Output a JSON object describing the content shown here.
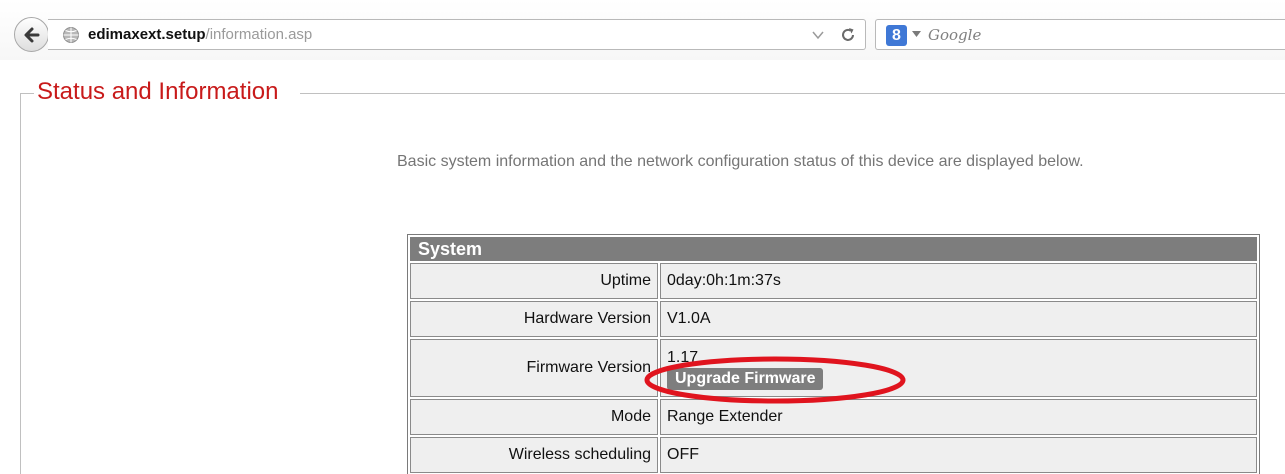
{
  "browser": {
    "url_host": "edimaxext.setup",
    "url_path": "/information.asp",
    "search_engine_label": "8",
    "search_placeholder": "Google"
  },
  "page": {
    "title": "Status and Information",
    "intro": "Basic system information and the network configuration status of this device are displayed below."
  },
  "system": {
    "header": "System",
    "rows": [
      {
        "label": "Uptime",
        "value": "0day:0h:1m:37s"
      },
      {
        "label": "Hardware Version",
        "value": "V1.0A"
      },
      {
        "label": "Firmware Version",
        "value": "1.17",
        "button": "Upgrade Firmware"
      },
      {
        "label": "Mode",
        "value": "Range Extender"
      },
      {
        "label": "Wireless scheduling",
        "value": "OFF"
      }
    ]
  },
  "colors": {
    "title_red": "#c81a1a",
    "table_header": "#7d7d7d",
    "highlight": "#e0141e"
  },
  "icons": [
    "back-arrow-icon",
    "globe-icon",
    "dropdown-arrow-icon",
    "reload-icon",
    "search-engine-icon",
    "chevron-down-icon"
  ]
}
